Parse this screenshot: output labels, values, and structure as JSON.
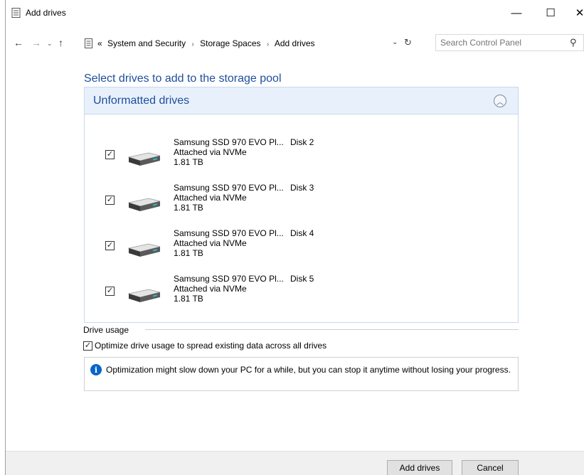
{
  "window": {
    "title": "Add drives",
    "minimize_glyph": "—",
    "maximize_glyph": "☐",
    "close_glyph": "✕"
  },
  "nav": {
    "back_glyph": "←",
    "forward_glyph": "→",
    "recent_glyph": "⌄",
    "up_glyph": "↑",
    "breadcrumb_overflow": "«",
    "breadcrumbs": [
      "System and Security",
      "Storage Spaces",
      "Add drives"
    ],
    "separator": "›",
    "dropdown_glyph": "⌄",
    "refresh_glyph": "↻"
  },
  "search": {
    "placeholder": "Search Control Panel",
    "icon_glyph": "⚲"
  },
  "main": {
    "heading": "Select drives to add to the storage pool",
    "section_title": "Unformatted drives",
    "collapse_glyph": "︿",
    "drives": [
      {
        "name": "Samsung SSD 970 EVO Pl...",
        "connection": "Attached via NVMe",
        "size": "1.81 TB",
        "disk": "Disk 2",
        "checked": true
      },
      {
        "name": "Samsung SSD 970 EVO Pl...",
        "connection": "Attached via NVMe",
        "size": "1.81 TB",
        "disk": "Disk 3",
        "checked": true
      },
      {
        "name": "Samsung SSD 970 EVO Pl...",
        "connection": "Attached via NVMe",
        "size": "1.81 TB",
        "disk": "Disk 4",
        "checked": true
      },
      {
        "name": "Samsung SSD 970 EVO Pl...",
        "connection": "Attached via NVMe",
        "size": "1.81 TB",
        "disk": "Disk 5",
        "checked": true
      }
    ]
  },
  "usage": {
    "legend": "Drive usage",
    "optimize_label": "Optimize drive usage to spread existing data across all drives",
    "optimize_checked": true,
    "info_text": "Optimization might slow down your PC for a while, but you can stop it anytime without losing your progress."
  },
  "footer": {
    "add_label": "Add drives",
    "cancel_label": "Cancel"
  },
  "colors": {
    "accent": "#1e4e9c",
    "header_bg": "#e8f1fb",
    "info_icon": "#0a64c8"
  }
}
